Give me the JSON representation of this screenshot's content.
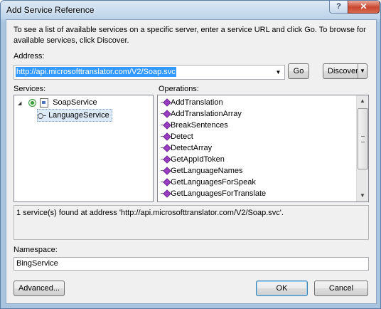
{
  "window": {
    "title": "Add Service Reference",
    "help_label": "?",
    "close_label": "✕"
  },
  "intro_text": "To see a list of available services on a specific server, enter a service URL and click Go. To browse for available services, click Discover.",
  "address": {
    "label": "Address:",
    "value": "http://api.microsofttranslator.com/V2/Soap.svc",
    "dropdown_glyph": "▼"
  },
  "buttons": {
    "go": "Go",
    "discover": "Discover",
    "discover_arrow": "▼",
    "advanced": "Advanced...",
    "ok": "OK",
    "cancel": "Cancel"
  },
  "services": {
    "label": "Services:",
    "tree": [
      {
        "label": "SoapService",
        "expand_glyph": "◢",
        "level": 0
      },
      {
        "label": "LanguageService",
        "level": 1,
        "selected": true
      }
    ]
  },
  "operations": {
    "label": "Operations:",
    "items": [
      "AddTranslation",
      "AddTranslationArray",
      "BreakSentences",
      "Detect",
      "DetectArray",
      "GetAppIdToken",
      "GetLanguageNames",
      "GetLanguagesForSpeak",
      "GetLanguagesForTranslate"
    ],
    "scroll_up_glyph": "▲",
    "scroll_down_glyph": "▼"
  },
  "status_text": "1 service(s) found at address 'http://api.microsofttranslator.com/V2/Soap.svc'.",
  "namespace": {
    "label": "Namespace:",
    "value": "BingService"
  },
  "colors": {
    "selection": "#3399ff",
    "operation_icon": "#9b3fc4",
    "close_button": "#c9462f"
  }
}
